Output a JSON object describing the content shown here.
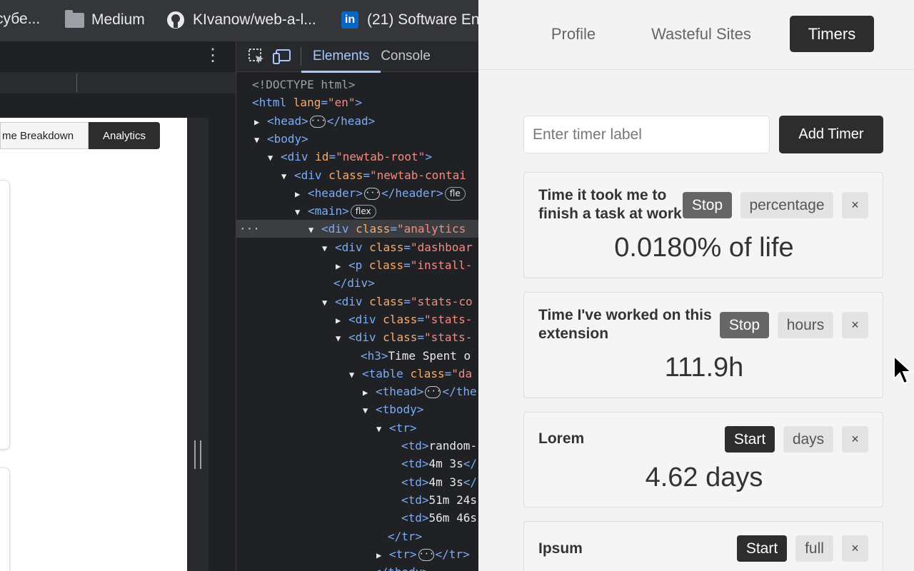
{
  "bookmarks": [
    {
      "icon": "",
      "label": "субе..."
    },
    {
      "icon": "folder-icon",
      "label": "Medium"
    },
    {
      "icon": "github-icon",
      "label": "KIvanow/web-a-l..."
    },
    {
      "icon": "linkedin-icon",
      "label": "(21) Software En..."
    }
  ],
  "preview": {
    "tab_breakdown": "me Breakdown",
    "tab_analytics": "Analytics"
  },
  "devtools": {
    "tabs": [
      "Elements",
      "Console"
    ],
    "active_tab": "Elements",
    "code_lines": [
      {
        "indent": 0,
        "tri": "",
        "parts": [
          {
            "c": "an",
            "t": "<!DOCTYPE html>"
          }
        ]
      },
      {
        "indent": 0,
        "tri": "",
        "parts": [
          {
            "c": "tg",
            "t": "<html "
          },
          {
            "c": "at",
            "t": "lang"
          },
          {
            "c": "tg",
            "t": "="
          },
          {
            "c": "av",
            "t": "\"en\""
          },
          {
            "c": "tg",
            "t": ">"
          }
        ]
      },
      {
        "indent": 1,
        "tri": "▶",
        "parts": [
          {
            "c": "tg",
            "t": "<head>"
          },
          {
            "c": "ell",
            "t": "···"
          },
          {
            "c": "tg",
            "t": "</head>"
          }
        ]
      },
      {
        "indent": 1,
        "tri": "▼",
        "parts": [
          {
            "c": "tg",
            "t": "<body>"
          }
        ]
      },
      {
        "indent": 2,
        "tri": "▼",
        "parts": [
          {
            "c": "tg",
            "t": "<div "
          },
          {
            "c": "at",
            "t": "id"
          },
          {
            "c": "tg",
            "t": "="
          },
          {
            "c": "av",
            "t": "\"newtab-root\""
          },
          {
            "c": "tg",
            "t": ">"
          }
        ]
      },
      {
        "indent": 3,
        "tri": "▼",
        "parts": [
          {
            "c": "tg",
            "t": "<div "
          },
          {
            "c": "at",
            "t": "class"
          },
          {
            "c": "tg",
            "t": "="
          },
          {
            "c": "av",
            "t": "\"newtab-contai"
          }
        ]
      },
      {
        "indent": 4,
        "tri": "▶",
        "parts": [
          {
            "c": "tg",
            "t": "<header>"
          },
          {
            "c": "ell",
            "t": "···"
          },
          {
            "c": "tg",
            "t": "</header>"
          },
          {
            "c": "pill",
            "t": "fle"
          }
        ]
      },
      {
        "indent": 4,
        "tri": "▼",
        "parts": [
          {
            "c": "tg",
            "t": "<main>"
          },
          {
            "c": "pill",
            "t": "flex"
          }
        ]
      },
      {
        "indent": 5,
        "tri": "▼",
        "sel": true,
        "parts": [
          {
            "c": "tg",
            "t": "<div "
          },
          {
            "c": "at",
            "t": "class"
          },
          {
            "c": "tg",
            "t": "="
          },
          {
            "c": "av",
            "t": "\"analytics"
          }
        ]
      },
      {
        "indent": 6,
        "tri": "▼",
        "parts": [
          {
            "c": "tg",
            "t": "<div "
          },
          {
            "c": "at",
            "t": "class"
          },
          {
            "c": "tg",
            "t": "="
          },
          {
            "c": "av",
            "t": "\"dashboar"
          }
        ]
      },
      {
        "indent": 7,
        "tri": "▶",
        "parts": [
          {
            "c": "tg",
            "t": "<p "
          },
          {
            "c": "at",
            "t": "class"
          },
          {
            "c": "tg",
            "t": "="
          },
          {
            "c": "av",
            "t": "\"install-"
          }
        ]
      },
      {
        "indent": 6,
        "tri": "",
        "parts": [
          {
            "c": "tg",
            "t": "</div>"
          }
        ]
      },
      {
        "indent": 6,
        "tri": "▼",
        "parts": [
          {
            "c": "tg",
            "t": "<div "
          },
          {
            "c": "at",
            "t": "class"
          },
          {
            "c": "tg",
            "t": "="
          },
          {
            "c": "av",
            "t": "\"stats-co"
          }
        ]
      },
      {
        "indent": 7,
        "tri": "▶",
        "parts": [
          {
            "c": "tg",
            "t": "<div "
          },
          {
            "c": "at",
            "t": "class"
          },
          {
            "c": "tg",
            "t": "="
          },
          {
            "c": "av",
            "t": "\"stats-"
          }
        ]
      },
      {
        "indent": 7,
        "tri": "▼",
        "parts": [
          {
            "c": "tg",
            "t": "<div "
          },
          {
            "c": "at",
            "t": "class"
          },
          {
            "c": "tg",
            "t": "="
          },
          {
            "c": "av",
            "t": "\"stats-"
          }
        ]
      },
      {
        "indent": 8,
        "tri": "",
        "parts": [
          {
            "c": "tg",
            "t": "<h3>"
          },
          {
            "c": "tx",
            "t": "Time Spent o"
          }
        ]
      },
      {
        "indent": 8,
        "tri": "▼",
        "parts": [
          {
            "c": "tg",
            "t": "<table "
          },
          {
            "c": "at",
            "t": "class"
          },
          {
            "c": "tg",
            "t": "="
          },
          {
            "c": "av",
            "t": "\"da"
          }
        ]
      },
      {
        "indent": 9,
        "tri": "▶",
        "parts": [
          {
            "c": "tg",
            "t": "<thead>"
          },
          {
            "c": "ell",
            "t": "···"
          },
          {
            "c": "tg",
            "t": "</the"
          }
        ]
      },
      {
        "indent": 9,
        "tri": "▼",
        "parts": [
          {
            "c": "tg",
            "t": "<tbody>"
          }
        ]
      },
      {
        "indent": 10,
        "tri": "▼",
        "parts": [
          {
            "c": "tg",
            "t": "<tr>"
          }
        ]
      },
      {
        "indent": 11,
        "tri": "",
        "parts": [
          {
            "c": "tg",
            "t": "<td>"
          },
          {
            "c": "tx",
            "t": "random-"
          }
        ]
      },
      {
        "indent": 11,
        "tri": "",
        "parts": [
          {
            "c": "tg",
            "t": "<td>"
          },
          {
            "c": "tx",
            "t": "4m 3s"
          },
          {
            "c": "tg",
            "t": "</"
          }
        ]
      },
      {
        "indent": 11,
        "tri": "",
        "parts": [
          {
            "c": "tg",
            "t": "<td>"
          },
          {
            "c": "tx",
            "t": "4m 3s"
          },
          {
            "c": "tg",
            "t": "</"
          }
        ]
      },
      {
        "indent": 11,
        "tri": "",
        "parts": [
          {
            "c": "tg",
            "t": "<td>"
          },
          {
            "c": "tx",
            "t": "51m 24s"
          }
        ]
      },
      {
        "indent": 11,
        "tri": "",
        "parts": [
          {
            "c": "tg",
            "t": "<td>"
          },
          {
            "c": "tx",
            "t": "56m 46s"
          }
        ]
      },
      {
        "indent": 10,
        "tri": "",
        "parts": [
          {
            "c": "tg",
            "t": "</tr>"
          }
        ]
      },
      {
        "indent": 10,
        "tri": "▶",
        "parts": [
          {
            "c": "tg",
            "t": "<tr>"
          },
          {
            "c": "ell",
            "t": "···"
          },
          {
            "c": "tg",
            "t": "</tr>"
          }
        ]
      },
      {
        "indent": 9,
        "tri": "",
        "parts": [
          {
            "c": "tg",
            "t": "</tbody>"
          }
        ]
      }
    ]
  },
  "popup": {
    "nav": [
      {
        "label": "Profile",
        "active": false
      },
      {
        "label": "Wasteful Sites",
        "active": false
      },
      {
        "label": "Timers",
        "active": true
      }
    ],
    "timer_input_placeholder": "Enter timer label",
    "add_timer_label": "Add Timer",
    "timers": [
      {
        "label": "Time it took me to finish a task at work",
        "action": "Stop",
        "mode": "percentage",
        "close": "×",
        "value": "0.0180% of life"
      },
      {
        "label": "Time I've worked on this extension",
        "action": "Stop",
        "mode": "hours",
        "close": "×",
        "value": "111.9h"
      },
      {
        "label": "Lorem",
        "action": "Start",
        "mode": "days",
        "close": "×",
        "value": "4.62 days"
      },
      {
        "label": "Ipsum",
        "action": "Start",
        "mode": "full",
        "close": "×",
        "value": ""
      }
    ]
  }
}
